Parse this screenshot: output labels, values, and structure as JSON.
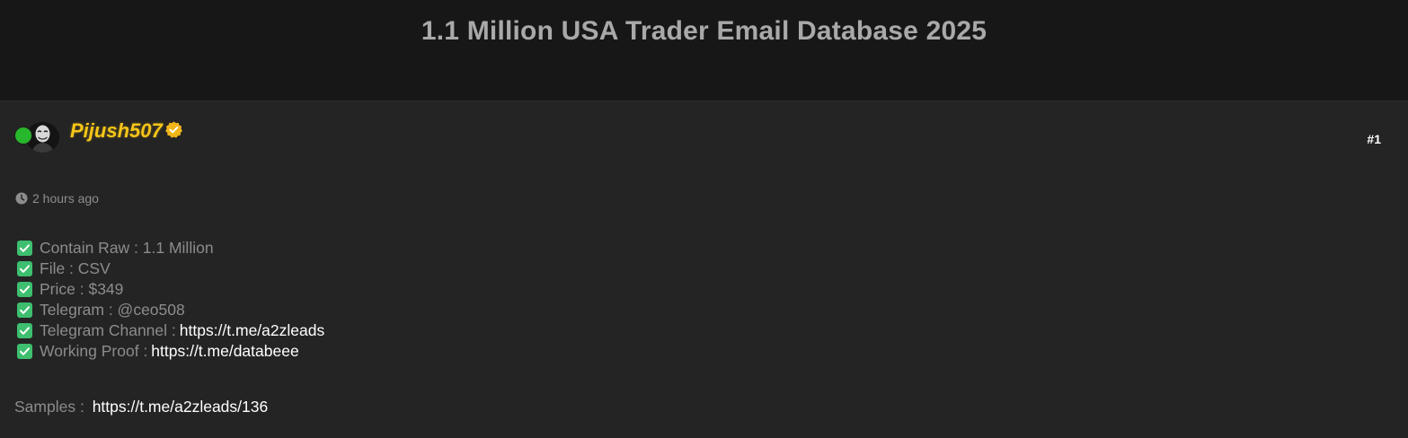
{
  "page": {
    "title": "1.1 Million USA Trader Email Database 2025"
  },
  "post": {
    "author": "Pijush507",
    "post_number": "#1",
    "timestamp": "2 hours ago",
    "features": [
      {
        "label": "Contain Raw : 1.1 Million",
        "link": ""
      },
      {
        "label": "File : CSV",
        "link": ""
      },
      {
        "label": "Price : $349",
        "link": ""
      },
      {
        "label": "Telegram : @ceo508",
        "link": ""
      },
      {
        "label": "Telegram Channel :",
        "link": "https://t.me/a2zleads"
      },
      {
        "label": "Working Proof :",
        "link": "https://t.me/databeee"
      }
    ],
    "samples_label": "Samples :",
    "samples_link": "https://t.me/a2zleads/136"
  },
  "colors": {
    "username": "#f5c518",
    "online": "#28b62c",
    "check": "#3dbf6f",
    "link": "#ffffff"
  },
  "icons": {
    "verified": "verified-badge-icon",
    "clock": "clock-icon",
    "check": "checkbox-check-icon"
  }
}
